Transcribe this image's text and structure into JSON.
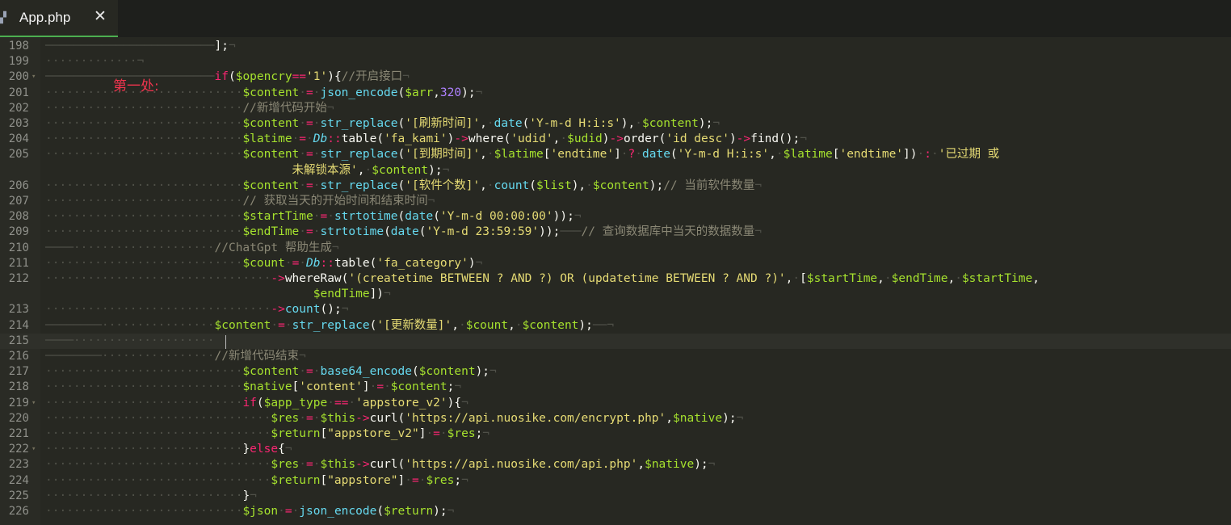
{
  "tab": {
    "title": "App.php",
    "close": "✕",
    "icon": "php-elephant-icon"
  },
  "annotation": "第一处:",
  "colors": {
    "background": "#272822",
    "keyword": "#f92672",
    "variable": "#a6e22e",
    "function": "#66d9ef",
    "string": "#e6db74",
    "number": "#ae81ff",
    "comment": "#8a8775"
  },
  "lines": [
    {
      "n": "198",
      "fold": "",
      "code": [
        [
          "w",
          "────────────────────────"
        ],
        [
          "p",
          "];"
        ],
        [
          "w",
          "¬"
        ]
      ]
    },
    {
      "n": "199",
      "fold": "",
      "code": [
        [
          "w",
          "·············¬"
        ]
      ]
    },
    {
      "n": "200",
      "fold": "▾",
      "code": [
        [
          "w",
          "────────────────────────"
        ],
        [
          "k",
          "if"
        ],
        [
          "p",
          "("
        ],
        [
          "v",
          "$opencry"
        ],
        [
          "k",
          "=="
        ],
        [
          "s",
          "'1'"
        ],
        [
          "p",
          "){"
        ],
        [
          "c",
          "//开启接口"
        ],
        [
          "w",
          "¬"
        ]
      ]
    },
    {
      "n": "201",
      "fold": "",
      "code": [
        [
          "w",
          "····························"
        ],
        [
          "v",
          "$content"
        ],
        [
          "w",
          "·"
        ],
        [
          "k",
          "="
        ],
        [
          "w",
          "·"
        ],
        [
          "f",
          "json_encode"
        ],
        [
          "p",
          "("
        ],
        [
          "v",
          "$arr"
        ],
        [
          "p",
          ","
        ],
        [
          "n",
          "320"
        ],
        [
          "p",
          ");"
        ],
        [
          "w",
          "¬"
        ]
      ]
    },
    {
      "n": "202",
      "fold": "",
      "code": [
        [
          "w",
          "····························"
        ],
        [
          "c",
          "//新增代码开始"
        ],
        [
          "w",
          "¬"
        ]
      ]
    },
    {
      "n": "203",
      "fold": "",
      "code": [
        [
          "w",
          "····························"
        ],
        [
          "v",
          "$content"
        ],
        [
          "w",
          "·"
        ],
        [
          "k",
          "="
        ],
        [
          "w",
          "·"
        ],
        [
          "f",
          "str_replace"
        ],
        [
          "p",
          "("
        ],
        [
          "s",
          "'[刷新时间]'"
        ],
        [
          "p",
          ","
        ],
        [
          "w",
          "·"
        ],
        [
          "f",
          "date"
        ],
        [
          "p",
          "("
        ],
        [
          "s",
          "'Y-m-d H:i:s'"
        ],
        [
          "p",
          "),"
        ],
        [
          "w",
          "·"
        ],
        [
          "v",
          "$content"
        ],
        [
          "p",
          ");"
        ],
        [
          "w",
          "¬"
        ]
      ]
    },
    {
      "n": "204",
      "fold": "",
      "code": [
        [
          "w",
          "····························"
        ],
        [
          "v",
          "$latime"
        ],
        [
          "w",
          "·"
        ],
        [
          "k",
          "="
        ],
        [
          "w",
          "·"
        ],
        [
          "ci",
          "Db"
        ],
        [
          "k",
          "::"
        ],
        [
          "p",
          "table("
        ],
        [
          "s",
          "'fa_kami'"
        ],
        [
          "p",
          ")"
        ],
        [
          "k",
          "->"
        ],
        [
          "p",
          "where("
        ],
        [
          "s",
          "'udid'"
        ],
        [
          "p",
          ","
        ],
        [
          "w",
          "·"
        ],
        [
          "v",
          "$udid"
        ],
        [
          "p",
          ")"
        ],
        [
          "k",
          "->"
        ],
        [
          "p",
          "order("
        ],
        [
          "s",
          "'id desc'"
        ],
        [
          "p",
          ")"
        ],
        [
          "k",
          "->"
        ],
        [
          "p",
          "find();"
        ],
        [
          "w",
          "¬"
        ]
      ]
    },
    {
      "n": "205",
      "fold": "",
      "code": [
        [
          "w",
          "····························"
        ],
        [
          "v",
          "$content"
        ],
        [
          "w",
          "·"
        ],
        [
          "k",
          "="
        ],
        [
          "w",
          "·"
        ],
        [
          "f",
          "str_replace"
        ],
        [
          "p",
          "("
        ],
        [
          "s",
          "'[到期时间]'"
        ],
        [
          "p",
          ","
        ],
        [
          "w",
          "·"
        ],
        [
          "v",
          "$latime"
        ],
        [
          "p",
          "["
        ],
        [
          "s",
          "'endtime'"
        ],
        [
          "p",
          "]"
        ],
        [
          "w",
          "·"
        ],
        [
          "k",
          "?"
        ],
        [
          "w",
          "·"
        ],
        [
          "f",
          "date"
        ],
        [
          "p",
          "("
        ],
        [
          "s",
          "'Y-m-d H:i:s'"
        ],
        [
          "p",
          ","
        ],
        [
          "w",
          "·"
        ],
        [
          "v",
          "$latime"
        ],
        [
          "p",
          "["
        ],
        [
          "s",
          "'endtime'"
        ],
        [
          "p",
          "])"
        ],
        [
          "w",
          "·"
        ],
        [
          "k",
          ":"
        ],
        [
          "w",
          "·"
        ],
        [
          "s",
          "'已过期 或"
        ]
      ]
    },
    {
      "n": "",
      "fold": "",
      "code": [
        [
          "w",
          "                                   "
        ],
        [
          "s",
          "未解锁本源'"
        ],
        [
          "p",
          ","
        ],
        [
          "w",
          "·"
        ],
        [
          "v",
          "$content"
        ],
        [
          "p",
          ");"
        ],
        [
          "w",
          "¬"
        ]
      ]
    },
    {
      "n": "206",
      "fold": "",
      "code": [
        [
          "w",
          "····························"
        ],
        [
          "v",
          "$content"
        ],
        [
          "w",
          "·"
        ],
        [
          "k",
          "="
        ],
        [
          "w",
          "·"
        ],
        [
          "f",
          "str_replace"
        ],
        [
          "p",
          "("
        ],
        [
          "s",
          "'[软件个数]'"
        ],
        [
          "p",
          ","
        ],
        [
          "w",
          "·"
        ],
        [
          "f",
          "count"
        ],
        [
          "p",
          "("
        ],
        [
          "v",
          "$list"
        ],
        [
          "p",
          "),"
        ],
        [
          "w",
          "·"
        ],
        [
          "v",
          "$content"
        ],
        [
          "p",
          ");"
        ],
        [
          "c",
          "// 当前软件数量"
        ],
        [
          "w",
          "¬"
        ]
      ]
    },
    {
      "n": "207",
      "fold": "",
      "code": [
        [
          "w",
          "····························"
        ],
        [
          "c",
          "// 获取当天的开始时间和结束时间"
        ],
        [
          "w",
          "¬"
        ]
      ]
    },
    {
      "n": "208",
      "fold": "",
      "code": [
        [
          "w",
          "····························"
        ],
        [
          "v",
          "$startTime"
        ],
        [
          "w",
          "·"
        ],
        [
          "k",
          "="
        ],
        [
          "w",
          "·"
        ],
        [
          "f",
          "strtotime"
        ],
        [
          "p",
          "("
        ],
        [
          "f",
          "date"
        ],
        [
          "p",
          "("
        ],
        [
          "s",
          "'Y-m-d 00:00:00'"
        ],
        [
          "p",
          "));"
        ],
        [
          "w",
          "¬"
        ]
      ]
    },
    {
      "n": "209",
      "fold": "",
      "code": [
        [
          "w",
          "····························"
        ],
        [
          "v",
          "$endTime"
        ],
        [
          "w",
          "·"
        ],
        [
          "k",
          "="
        ],
        [
          "w",
          "·"
        ],
        [
          "f",
          "strtotime"
        ],
        [
          "p",
          "("
        ],
        [
          "f",
          "date"
        ],
        [
          "p",
          "("
        ],
        [
          "s",
          "'Y-m-d 23:59:59'"
        ],
        [
          "p",
          "));"
        ],
        [
          "w",
          "───"
        ],
        [
          "c",
          "// 查询数据库中当天的数据数量"
        ],
        [
          "w",
          "¬"
        ]
      ]
    },
    {
      "n": "210",
      "fold": "",
      "code": [
        [
          "w",
          "────····················"
        ],
        [
          "c",
          "//ChatGpt 帮助生成"
        ],
        [
          "w",
          "¬"
        ]
      ]
    },
    {
      "n": "211",
      "fold": "",
      "code": [
        [
          "w",
          "····························"
        ],
        [
          "v",
          "$count"
        ],
        [
          "w",
          "·"
        ],
        [
          "k",
          "="
        ],
        [
          "w",
          "·"
        ],
        [
          "ci",
          "Db"
        ],
        [
          "k",
          "::"
        ],
        [
          "p",
          "table("
        ],
        [
          "s",
          "'fa_category'"
        ],
        [
          "p",
          ")"
        ],
        [
          "w",
          "¬"
        ]
      ]
    },
    {
      "n": "212",
      "fold": "",
      "code": [
        [
          "w",
          "································"
        ],
        [
          "k",
          "->"
        ],
        [
          "p",
          "whereRaw("
        ],
        [
          "s",
          "'(createtime BETWEEN ? AND ?) OR (updatetime BETWEEN ? AND ?)'"
        ],
        [
          "p",
          ","
        ],
        [
          "w",
          "·"
        ],
        [
          "p",
          "["
        ],
        [
          "v",
          "$startTime"
        ],
        [
          "p",
          ","
        ],
        [
          "w",
          "·"
        ],
        [
          "v",
          "$endTime"
        ],
        [
          "p",
          ","
        ],
        [
          "w",
          "·"
        ],
        [
          "v",
          "$startTime"
        ],
        [
          "p",
          ","
        ]
      ]
    },
    {
      "n": "",
      "fold": "",
      "code": [
        [
          "w",
          "                                      "
        ],
        [
          "v",
          "$endTime"
        ],
        [
          "p",
          "])"
        ],
        [
          "w",
          "¬"
        ]
      ]
    },
    {
      "n": "213",
      "fold": "",
      "code": [
        [
          "w",
          "································"
        ],
        [
          "k",
          "->"
        ],
        [
          "f",
          "count"
        ],
        [
          "p",
          "();"
        ],
        [
          "w",
          "¬"
        ]
      ]
    },
    {
      "n": "214",
      "fold": "",
      "code": [
        [
          "w",
          "────────················"
        ],
        [
          "v",
          "$content"
        ],
        [
          "w",
          "·"
        ],
        [
          "k",
          "="
        ],
        [
          "w",
          "·"
        ],
        [
          "f",
          "str_replace"
        ],
        [
          "p",
          "("
        ],
        [
          "s",
          "'[更新数量]'"
        ],
        [
          "p",
          ","
        ],
        [
          "w",
          "·"
        ],
        [
          "v",
          "$count"
        ],
        [
          "p",
          ","
        ],
        [
          "w",
          "·"
        ],
        [
          "v",
          "$content"
        ],
        [
          "p",
          ");"
        ],
        [
          "w",
          "──¬"
        ]
      ]
    },
    {
      "n": "215",
      "fold": "",
      "code": [
        [
          "w",
          "────····················"
        ]
      ]
    },
    {
      "n": "216",
      "fold": "",
      "code": [
        [
          "w",
          "────────················"
        ],
        [
          "c",
          "//新增代码结束"
        ],
        [
          "w",
          "¬"
        ]
      ]
    },
    {
      "n": "217",
      "fold": "",
      "code": [
        [
          "w",
          "····························"
        ],
        [
          "v",
          "$content"
        ],
        [
          "w",
          "·"
        ],
        [
          "k",
          "="
        ],
        [
          "w",
          "·"
        ],
        [
          "f",
          "base64_encode"
        ],
        [
          "p",
          "("
        ],
        [
          "v",
          "$content"
        ],
        [
          "p",
          ");"
        ],
        [
          "w",
          "¬"
        ]
      ]
    },
    {
      "n": "218",
      "fold": "",
      "code": [
        [
          "w",
          "····························"
        ],
        [
          "v",
          "$native"
        ],
        [
          "p",
          "["
        ],
        [
          "s",
          "'content'"
        ],
        [
          "p",
          "]"
        ],
        [
          "w",
          "·"
        ],
        [
          "k",
          "="
        ],
        [
          "w",
          "·"
        ],
        [
          "v",
          "$content"
        ],
        [
          "p",
          ";"
        ],
        [
          "w",
          "¬"
        ]
      ]
    },
    {
      "n": "219",
      "fold": "▾",
      "code": [
        [
          "w",
          "····························"
        ],
        [
          "k",
          "if"
        ],
        [
          "p",
          "("
        ],
        [
          "v",
          "$app_type"
        ],
        [
          "w",
          "·"
        ],
        [
          "k",
          "=="
        ],
        [
          "w",
          "·"
        ],
        [
          "s",
          "'appstore_v2'"
        ],
        [
          "p",
          "){"
        ],
        [
          "w",
          "¬"
        ]
      ]
    },
    {
      "n": "220",
      "fold": "",
      "code": [
        [
          "w",
          "································"
        ],
        [
          "v",
          "$res"
        ],
        [
          "w",
          "·"
        ],
        [
          "k",
          "="
        ],
        [
          "w",
          "·"
        ],
        [
          "v",
          "$this"
        ],
        [
          "k",
          "->"
        ],
        [
          "p",
          "curl("
        ],
        [
          "s",
          "'https://api.nuosike.com/encrypt.php'"
        ],
        [
          "p",
          ","
        ],
        [
          "v",
          "$native"
        ],
        [
          "p",
          ");"
        ],
        [
          "w",
          "¬"
        ]
      ]
    },
    {
      "n": "221",
      "fold": "",
      "code": [
        [
          "w",
          "································"
        ],
        [
          "v",
          "$return"
        ],
        [
          "p",
          "["
        ],
        [
          "s",
          "\"appstore_v2\""
        ],
        [
          "p",
          "]"
        ],
        [
          "w",
          "·"
        ],
        [
          "k",
          "="
        ],
        [
          "w",
          "·"
        ],
        [
          "v",
          "$res"
        ],
        [
          "p",
          ";"
        ],
        [
          "w",
          "¬"
        ]
      ]
    },
    {
      "n": "222",
      "fold": "▾",
      "code": [
        [
          "w",
          "····························"
        ],
        [
          "p",
          "}"
        ],
        [
          "k",
          "else"
        ],
        [
          "p",
          "{"
        ],
        [
          "w",
          "¬"
        ]
      ]
    },
    {
      "n": "223",
      "fold": "",
      "code": [
        [
          "w",
          "································"
        ],
        [
          "v",
          "$res"
        ],
        [
          "w",
          "·"
        ],
        [
          "k",
          "="
        ],
        [
          "w",
          "·"
        ],
        [
          "v",
          "$this"
        ],
        [
          "k",
          "->"
        ],
        [
          "p",
          "curl("
        ],
        [
          "s",
          "'https://api.nuosike.com/api.php'"
        ],
        [
          "p",
          ","
        ],
        [
          "v",
          "$native"
        ],
        [
          "p",
          ");"
        ],
        [
          "w",
          "¬"
        ]
      ]
    },
    {
      "n": "224",
      "fold": "",
      "code": [
        [
          "w",
          "································"
        ],
        [
          "v",
          "$return"
        ],
        [
          "p",
          "["
        ],
        [
          "s",
          "\"appstore\""
        ],
        [
          "p",
          "]"
        ],
        [
          "w",
          "·"
        ],
        [
          "k",
          "="
        ],
        [
          "w",
          "·"
        ],
        [
          "v",
          "$res"
        ],
        [
          "p",
          ";"
        ],
        [
          "w",
          "¬"
        ]
      ]
    },
    {
      "n": "225",
      "fold": "",
      "code": [
        [
          "w",
          "····························"
        ],
        [
          "p",
          "}"
        ],
        [
          "w",
          "¬"
        ]
      ]
    },
    {
      "n": "226",
      "fold": "",
      "code": [
        [
          "w",
          "····························"
        ],
        [
          "v",
          "$json"
        ],
        [
          "w",
          "·"
        ],
        [
          "k",
          "="
        ],
        [
          "w",
          "·"
        ],
        [
          "f",
          "json_encode"
        ],
        [
          "p",
          "("
        ],
        [
          "v",
          "$return"
        ],
        [
          "p",
          ");"
        ],
        [
          "w",
          "¬"
        ]
      ]
    }
  ]
}
